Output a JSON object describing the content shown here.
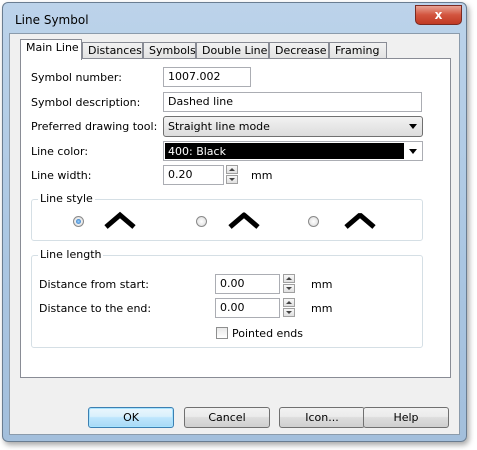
{
  "window": {
    "title": "Line Symbol",
    "close_glyph": "x"
  },
  "tabs": [
    {
      "label": "Main Line",
      "active": true
    },
    {
      "label": "Distances",
      "active": false
    },
    {
      "label": "Symbols",
      "active": false
    },
    {
      "label": "Double Line",
      "active": false
    },
    {
      "label": "Decrease",
      "active": false
    },
    {
      "label": "Framing",
      "active": false
    }
  ],
  "main_line": {
    "symbol_number": {
      "label": "Symbol number:",
      "value": "1007.002"
    },
    "symbol_description": {
      "label": "Symbol description:",
      "value": "Dashed line"
    },
    "drawing_tool": {
      "label": "Preferred drawing tool:",
      "value": "Straight line mode"
    },
    "line_color": {
      "label": "Line color:",
      "value": "400: Black",
      "swatch": "#000000"
    },
    "line_width": {
      "label": "Line width:",
      "value": "0.20",
      "unit": "mm"
    }
  },
  "line_style": {
    "legend": "Line style",
    "options": [
      {
        "icon": "miter-join-icon",
        "checked": true
      },
      {
        "icon": "round-join-icon",
        "checked": false
      },
      {
        "icon": "bevel-join-icon",
        "checked": false
      }
    ]
  },
  "line_length": {
    "legend": "Line length",
    "distance_from_start": {
      "label": "Distance from start:",
      "value": "0.00",
      "unit": "mm"
    },
    "distance_to_end": {
      "label": "Distance to the end:",
      "value": "0.00",
      "unit": "mm"
    },
    "pointed_ends": {
      "label": "Pointed ends",
      "checked": false
    }
  },
  "buttons": {
    "ok": "OK",
    "cancel": "Cancel",
    "icon": "Icon...",
    "help": "Help"
  },
  "colors": {
    "accent": "#3c7fb1",
    "title_bar": "#b9d1ea",
    "close": "#c8462f"
  }
}
